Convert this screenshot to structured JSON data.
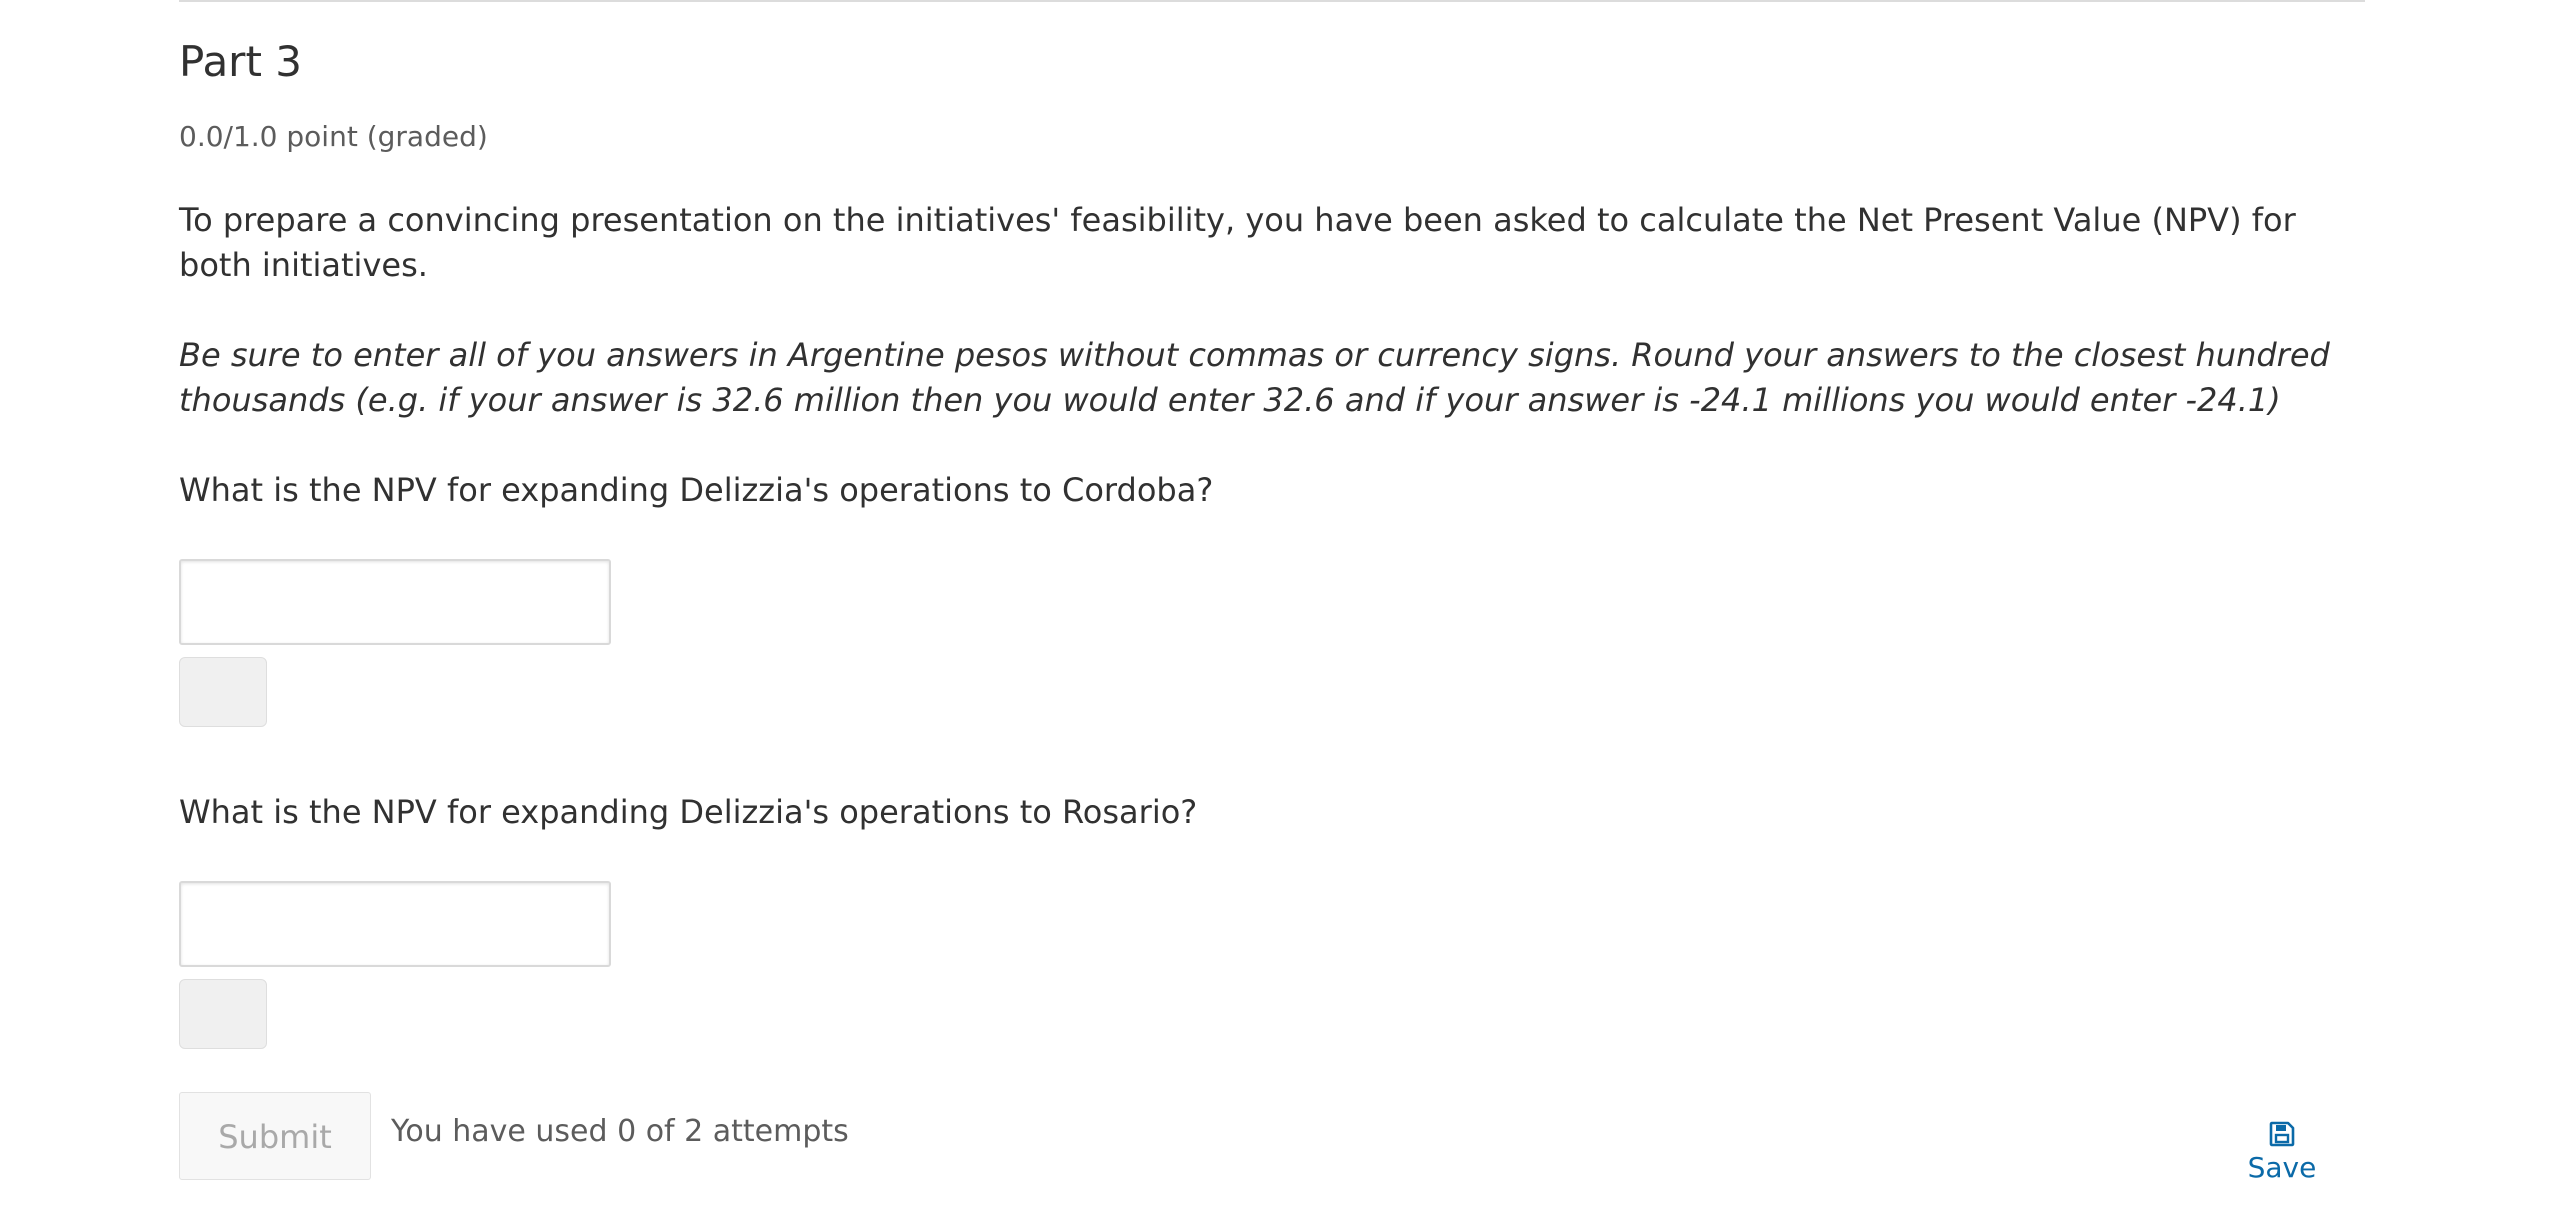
{
  "problem": {
    "title": "Part 3",
    "points": "0.0/1.0 point (graded)",
    "intro": "To prepare a convincing presentation on the initiatives' feasibility, you have been asked to calculate the Net Present Value (NPV) for both initiatives.",
    "instructions": "Be sure to enter all of you answers in Argentine pesos without commas or currency signs. Round your answers to the closest hundred thousands (e.g. if your answer is 32.6 million then you would enter 32.6 and if your answer is -24.1 millions you would enter -24.1)"
  },
  "questions": [
    {
      "prompt": "What is the NPV for expanding Delizzia's operations to Cordoba?",
      "value": ""
    },
    {
      "prompt": "What is the NPV for expanding Delizzia's operations to Rosario?",
      "value": ""
    }
  ],
  "actions": {
    "submit_label": "Submit",
    "attempts_text": "You have used 0 of 2 attempts",
    "save_label": "Save",
    "save_icon": "floppy-disk-icon",
    "link_color": "#0b6aa8"
  }
}
